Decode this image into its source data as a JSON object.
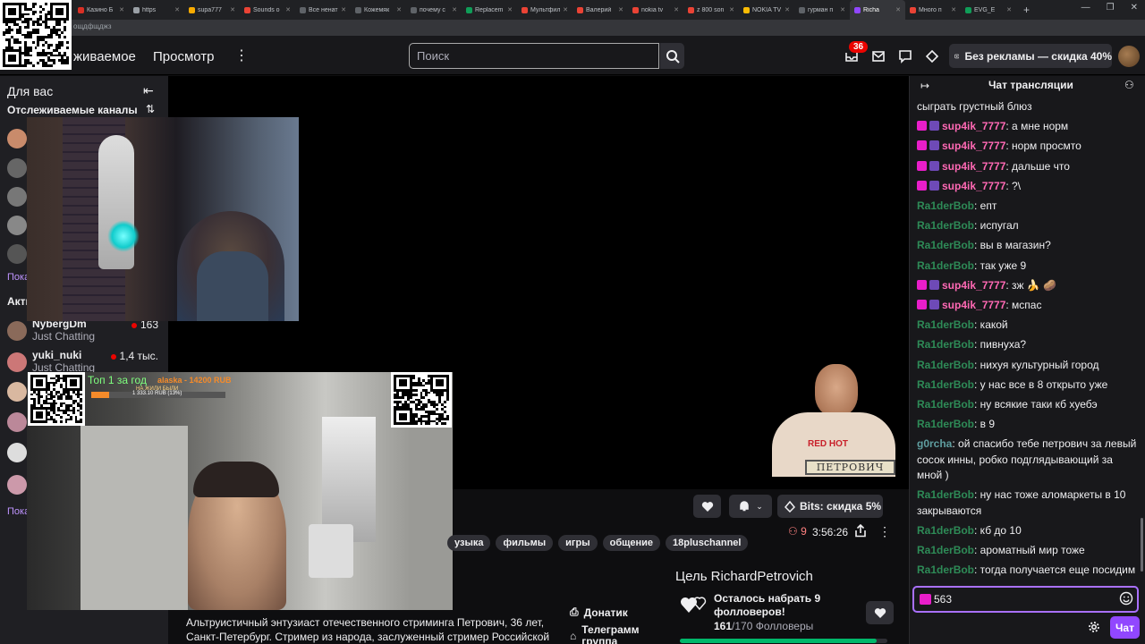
{
  "browser": {
    "tabs": [
      {
        "label": "Казино Б",
        "color": "#d93025"
      },
      {
        "label": "https",
        "color": "#9aa0a6"
      },
      {
        "label": "supa777",
        "color": "#f9ab00"
      },
      {
        "label": "Sounds o",
        "color": "#ea4335"
      },
      {
        "label": "Все ненат",
        "color": "#5f6368"
      },
      {
        "label": "Кожемяк",
        "color": "#5f6368"
      },
      {
        "label": "почему с",
        "color": "#5f6368"
      },
      {
        "label": "Replacem",
        "color": "#0f9d58"
      },
      {
        "label": "Мультфил",
        "color": "#ea4335"
      },
      {
        "label": "Валерий",
        "color": "#ea4335"
      },
      {
        "label": "nokia tv",
        "color": "#ea4335"
      },
      {
        "label": "z 800 son",
        "color": "#ea4335"
      },
      {
        "label": "NOKIA TV",
        "color": "#fbbc04"
      },
      {
        "label": "гурман п",
        "color": "#5f6368"
      },
      {
        "label": "Richa",
        "color": "#9147ff",
        "active": true
      },
      {
        "label": "Много п",
        "color": "#ea4335"
      },
      {
        "label": "EVG_E",
        "color": "#0f9d58"
      }
    ],
    "new_tab": "+",
    "url_fragment": "ощдфщджз"
  },
  "nav": {
    "following": "живаемое",
    "browse": "Просмотр",
    "search_placeholder": "Поиск",
    "notifications_count": "36",
    "turbo_label": "Без рекламы — скидка 40%"
  },
  "sidebar": {
    "for_you": "Для вас",
    "followed_channels": "Отслеживаемые каналы",
    "show_more_1": "Пока",
    "active_label": "Акти",
    "channels": [
      {
        "name": "NybergDm",
        "category": "Just Chatting",
        "viewers": "163",
        "color": "#8a6a5a"
      },
      {
        "name": "yuki_nuki",
        "category": "Just Chatting",
        "viewers": "1,4 тыс.",
        "color": "#c77"
      }
    ],
    "show_more_2": "Пока"
  },
  "overlay": {
    "top_label": "Топ 1 за год",
    "donor": "alaska - 14200 RUB",
    "subtitle": "НА ЖИЛИ БЫЛИ",
    "amount": "1 333.10 RUB (13%)",
    "petrovich_sign": "ПЕТРОВИЧ",
    "shirt_text": "RED HOT"
  },
  "actions": {
    "bits_label": "Bits: скидка 5%"
  },
  "stream": {
    "tags": [
      "узыка",
      "фильмы",
      "игры",
      "общение",
      "18pluschannel"
    ],
    "viewers": "9",
    "uptime": "3:56:26"
  },
  "goal": {
    "title": "Цель RichardPetrovich",
    "text": "Осталось набрать 9 фолловеров!",
    "current": "161",
    "total_label": "/170 Фолловеры",
    "progress": 0.947
  },
  "about": {
    "text": "Альтруистичный энтузиаст отечественного стриминга Петрович, 36 лет, Санкт-Петербург. Стример из народа, заслуженный стример Российской",
    "link_donatik": "Донатик",
    "link_telegram": "Телеграмм",
    "link_telegram_2": "группа"
  },
  "chat": {
    "title": "Чат трансляции",
    "input_value": "563",
    "send_label": "Чат",
    "messages": [
      {
        "user": "",
        "text": "сыграть грустный блюз",
        "color": "#efeff1",
        "badges": false
      },
      {
        "user": "sup4ik_7777",
        "text": ": а мне норм",
        "color": "#ff69b4",
        "badges": true
      },
      {
        "user": "sup4ik_7777",
        "text": ": норм просмто",
        "color": "#ff69b4",
        "badges": true
      },
      {
        "user": "sup4ik_7777",
        "text": ": дальше что",
        "color": "#ff69b4",
        "badges": true
      },
      {
        "user": "sup4ik_7777",
        "text": ": ?\\",
        "color": "#ff69b4",
        "badges": true
      },
      {
        "user": "Ra1derBob",
        "text": ": епт",
        "color": "#2e8b57",
        "badges": false
      },
      {
        "user": "Ra1derBob",
        "text": ": испугал",
        "color": "#2e8b57",
        "badges": false
      },
      {
        "user": "Ra1derBob",
        "text": ": вы в магазин?",
        "color": "#2e8b57",
        "badges": false
      },
      {
        "user": "Ra1derBob",
        "text": ": так уже 9",
        "color": "#2e8b57",
        "badges": false
      },
      {
        "user": "sup4ik_7777",
        "text": ": зж 🍌 🥔",
        "color": "#ff69b4",
        "badges": true
      },
      {
        "user": "sup4ik_7777",
        "text": ": мспас",
        "color": "#ff69b4",
        "badges": true
      },
      {
        "user": "Ra1derBob",
        "text": ": какой",
        "color": "#2e8b57",
        "badges": false
      },
      {
        "user": "Ra1derBob",
        "text": ": пивнуха?",
        "color": "#2e8b57",
        "badges": false
      },
      {
        "user": "Ra1derBob",
        "text": ": нихуя культурный город",
        "color": "#2e8b57",
        "badges": false
      },
      {
        "user": "Ra1derBob",
        "text": ": у нас все в 8 открыто уже",
        "color": "#2e8b57",
        "badges": false
      },
      {
        "user": "Ra1derBob",
        "text": ": ну всякие таки кб хуебэ",
        "color": "#2e8b57",
        "badges": false
      },
      {
        "user": "Ra1derBob",
        "text": ": в 9",
        "color": "#2e8b57",
        "badges": false
      },
      {
        "user": "g0rcha",
        "text": ": ой спасибо тебе петрович за левый сосок инны, робко подглядывающий за мной )",
        "color": "#5f9ea0",
        "badges": false
      },
      {
        "user": "Ra1derBob",
        "text": ": ну нас тоже аломаркеты в 10 закрываются",
        "color": "#2e8b57",
        "badges": false
      },
      {
        "user": "Ra1derBob",
        "text": ": кб до 10",
        "color": "#2e8b57",
        "badges": false
      },
      {
        "user": "Ra1derBob",
        "text": ": ароматный мир тоже",
        "color": "#2e8b57",
        "badges": false
      },
      {
        "user": "Ra1derBob",
        "text": ": тогда получается еще посидим",
        "color": "#2e8b57",
        "badges": false
      }
    ]
  }
}
